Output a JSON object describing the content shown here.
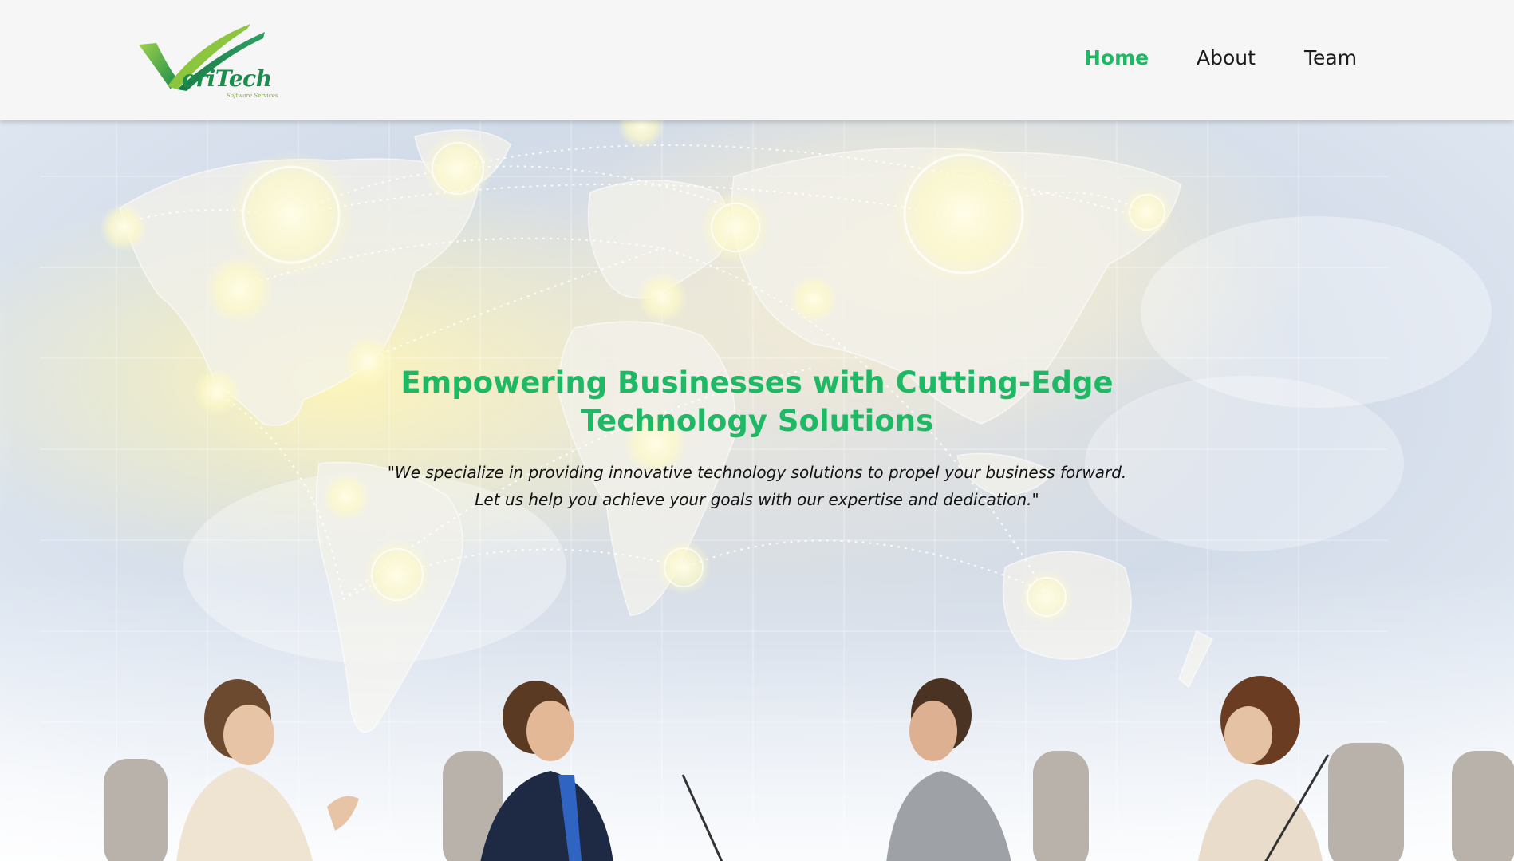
{
  "brand": {
    "logo_text": "eriTech",
    "logo_tagline": "Software Services",
    "colors": {
      "primary": "#1fb865",
      "logo_dark": "#1a7a44",
      "logo_light": "#7dc243"
    }
  },
  "nav": {
    "items": [
      {
        "label": "Home",
        "active": true
      },
      {
        "label": "About",
        "active": false
      },
      {
        "label": "Team",
        "active": false
      }
    ]
  },
  "hero": {
    "title": "Empowering Businesses with Cutting-Edge Technology Solutions",
    "subtitle": "\"We specialize in providing innovative technology solutions to propel your business forward. Let us help you achieve your goals with our expertise and dedication.\"",
    "background": "world-map-network-with-business-people-image"
  }
}
